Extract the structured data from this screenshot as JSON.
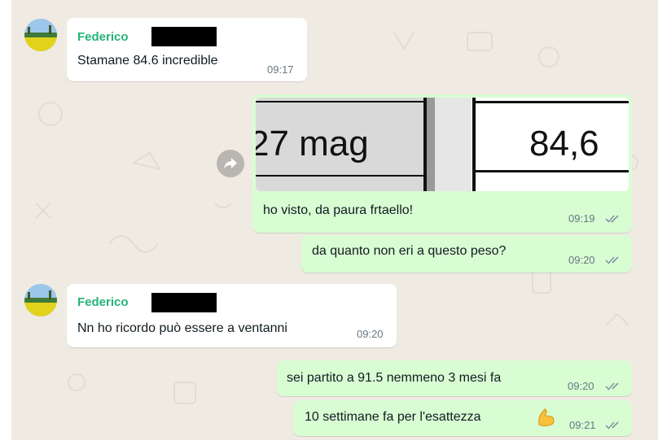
{
  "messages": [
    {
      "sender": "Federico",
      "text": "Stamane 84.6 incredible",
      "time": "09:17"
    },
    {
      "image": {
        "date_cell": "27 mag",
        "value_cell": "84,6"
      },
      "text": "ho visto, da paura frtaello!",
      "time": "09:19"
    },
    {
      "text": "da quanto non eri a questo peso?",
      "time": "09:20"
    },
    {
      "sender": "Federico",
      "text": "Nn ho ricordo può essere a ventanni",
      "time": "09:20"
    },
    {
      "text": "sei partito a 91.5 nemmeno 3 mesi fa",
      "time": "09:20"
    },
    {
      "text": "10 settimane fa per l'esattezza",
      "emoji": "flexed-biceps",
      "time": "09:21"
    }
  ],
  "colors": {
    "chat_background": "#efeae2",
    "incoming_bubble": "#ffffff",
    "outgoing_bubble": "#d9fdd3",
    "sender_name": "#25b27a",
    "timestamp": "#667781",
    "read_ticks": "#8696a0"
  },
  "icons": [
    "avatar",
    "forward-icon",
    "double-check-icon",
    "flexed-biceps-emoji"
  ]
}
